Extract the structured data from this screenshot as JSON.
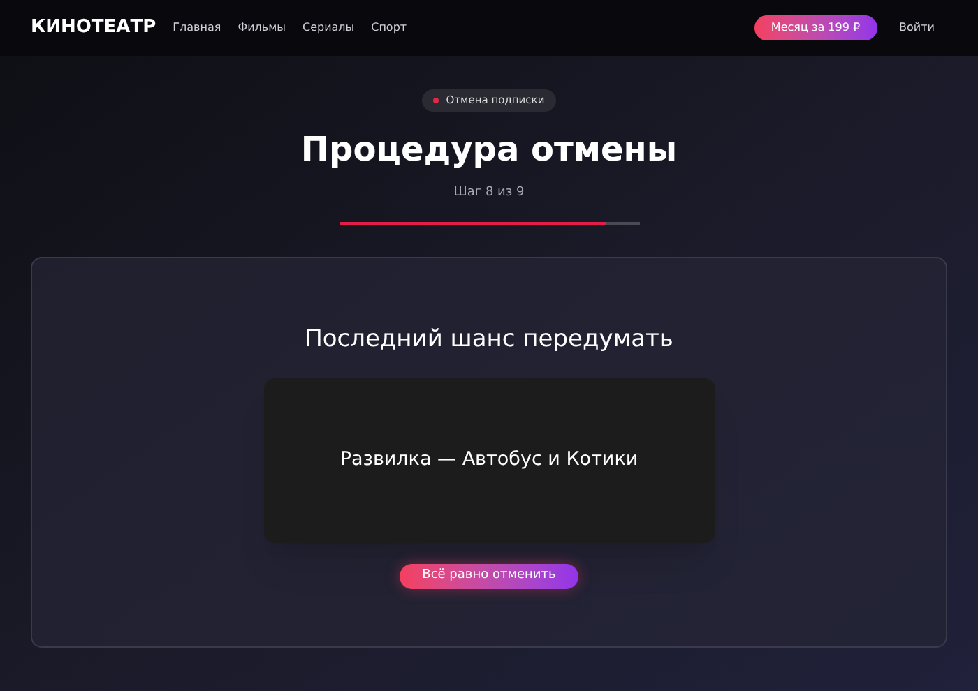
{
  "header": {
    "logo": "КИНОТЕАТР",
    "nav": [
      {
        "label": "Главная"
      },
      {
        "label": "Фильмы"
      },
      {
        "label": "Сериалы"
      },
      {
        "label": "Спорт"
      }
    ],
    "cta": "Месяц за 199 ₽",
    "login": "Войти"
  },
  "badge": "Отмена подписки",
  "title": "Процедура отмены",
  "step": "Шаг 8 из 9",
  "progress": {
    "level": 0.89
  },
  "card": {
    "heading": "Последний шанс передумать",
    "offer": "Развилка — Автобус и Котики",
    "button": "Всё равно отменить"
  }
}
